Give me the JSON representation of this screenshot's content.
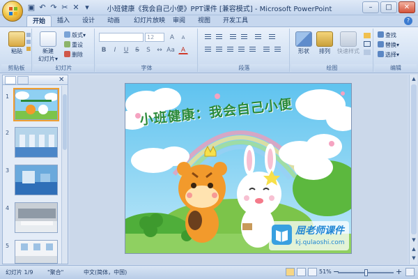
{
  "window": {
    "title": "小班健康《我会自己小便》PPT课件 [兼容模式] - Microsoft PowerPoint",
    "controls": [
      "–",
      "□",
      "✕"
    ]
  },
  "qat": {
    "icons": [
      "save-icon",
      "undo-icon",
      "redo-icon",
      "cut-icon",
      "delete-icon",
      "dropdown-icon"
    ]
  },
  "tabs": [
    "开始",
    "插入",
    "设计",
    "动画",
    "幻灯片放映",
    "审阅",
    "视图",
    "开发工具"
  ],
  "ribbon": {
    "clipboard": {
      "label": "剪贴板",
      "paste": "粘贴"
    },
    "slides": {
      "label": "幻灯片",
      "new_slide": "新建\n幻灯片",
      "new_slide_line1": "新建",
      "new_slide_line2": "幻灯片▾",
      "layout": "版式▾",
      "reset": "重设",
      "delete": "删除"
    },
    "font": {
      "label": "字体",
      "font_name": "",
      "font_size": "12"
    },
    "paragraph": {
      "label": "段落"
    },
    "drawing": {
      "label": "绘图",
      "shapes": "形状",
      "arrange": "排列",
      "quick_styles": "快速样式"
    },
    "editing": {
      "label": "编辑",
      "find": "查找",
      "replace": "替换▾",
      "select": "选择▾"
    }
  },
  "slide_pane": {
    "thumbnails": [
      {
        "number": "1",
        "selected": true,
        "theme": "title"
      },
      {
        "number": "2",
        "selected": false,
        "theme": "restroom-1"
      },
      {
        "number": "3",
        "selected": false,
        "theme": "restroom-2"
      },
      {
        "number": "4",
        "selected": false,
        "theme": "restroom-3"
      },
      {
        "number": "5",
        "selected": false,
        "theme": "restroom-4"
      }
    ]
  },
  "slide": {
    "title": "小班健康：我会自己小便",
    "watermark_title": "屈老师课件",
    "watermark_url": "kj.qulaoshi.com"
  },
  "status": {
    "slide_info": "幻灯片 1/9",
    "theme": "\"聚合\"",
    "language": "中文(简体，中国)",
    "zoom": "51%"
  },
  "colors": {
    "title_green": "#2b8a3a",
    "watermark_blue": "#2186d4",
    "ribbon_blue": "#d5e3f4"
  }
}
